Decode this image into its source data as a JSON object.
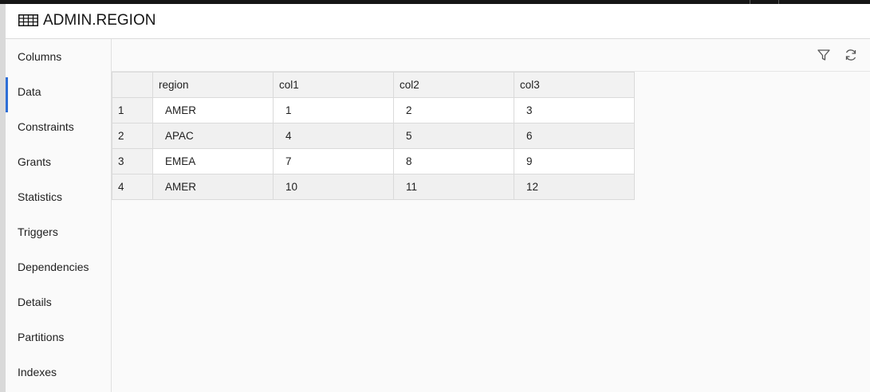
{
  "header": {
    "title": "ADMIN.REGION",
    "icon": "table-icon"
  },
  "sidebar": {
    "items": [
      {
        "label": "Columns",
        "active": false
      },
      {
        "label": "Data",
        "active": true
      },
      {
        "label": "Constraints",
        "active": false
      },
      {
        "label": "Grants",
        "active": false
      },
      {
        "label": "Statistics",
        "active": false
      },
      {
        "label": "Triggers",
        "active": false
      },
      {
        "label": "Dependencies",
        "active": false
      },
      {
        "label": "Details",
        "active": false
      },
      {
        "label": "Partitions",
        "active": false
      },
      {
        "label": "Indexes",
        "active": false
      }
    ]
  },
  "toolbar": {
    "filter_icon": "filter-icon",
    "refresh_icon": "refresh-icon"
  },
  "grid": {
    "columns": [
      "region",
      "col1",
      "col2",
      "col3"
    ],
    "rows": [
      {
        "num": "1",
        "cells": [
          "AMER",
          "1",
          "2",
          "3"
        ]
      },
      {
        "num": "2",
        "cells": [
          "APAC",
          "4",
          "5",
          "6"
        ]
      },
      {
        "num": "3",
        "cells": [
          "EMEA",
          "7",
          "8",
          "9"
        ]
      },
      {
        "num": "4",
        "cells": [
          "AMER",
          "10",
          "11",
          "12"
        ]
      }
    ]
  },
  "colors": {
    "accent": "#2f6fd6",
    "header_bg": "#f2f2f2",
    "alt_row_bg": "#f0f0f0"
  }
}
